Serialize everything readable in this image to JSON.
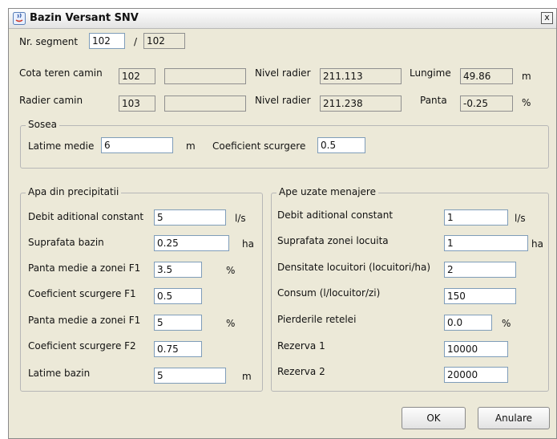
{
  "window": {
    "title": "Bazin Versant SNV",
    "close_glyph": "x"
  },
  "segment": {
    "label": "Nr. segment",
    "value": "102",
    "separator": "/",
    "total": "102"
  },
  "row_cota": {
    "label": "Cota teren camin",
    "value": "102",
    "value2": "",
    "nivel_label": "Nivel radier",
    "nivel_value": "211.113",
    "lungime_label": "Lungime",
    "lungime_value": "49.86",
    "unit": "m"
  },
  "row_radier": {
    "label": "Radier camin",
    "value": "103",
    "value2": "",
    "nivel_label": "Nivel radier",
    "nivel_value": "211.238",
    "panta_label": "Panta",
    "panta_value": "-0.25",
    "unit": "%"
  },
  "sosea": {
    "title": "Sosea",
    "latime_label": "Latime medie",
    "latime_value": "6",
    "latime_unit": "m",
    "coef_label": "Coeficient scurgere",
    "coef_value": "0.5"
  },
  "precipitatii": {
    "title": "Apa din precipitatii",
    "rows": [
      {
        "label": "Debit aditional constant",
        "value": "5",
        "unit": "l/s"
      },
      {
        "label": "Suprafata bazin",
        "value": "0.25",
        "unit": "ha"
      },
      {
        "label": "Panta medie a zonei F1",
        "value": "3.5",
        "unit": "%"
      },
      {
        "label": "Coeficient scurgere F1",
        "value": "0.5",
        "unit": ""
      },
      {
        "label": "Panta medie a zonei F1",
        "value": "5",
        "unit": "%"
      },
      {
        "label": "Coeficient scurgere F2",
        "value": "0.75",
        "unit": ""
      },
      {
        "label": "Latime bazin",
        "value": "5",
        "unit": "m"
      }
    ]
  },
  "menajere": {
    "title": "Ape uzate menajere",
    "rows": [
      {
        "label": "Debit aditional constant",
        "value": "1",
        "unit": "l/s"
      },
      {
        "label": "Suprafata zonei locuita",
        "value": "1",
        "unit": "ha"
      },
      {
        "label": "Densitate locuitori (locuitori/ha)",
        "value": "2",
        "unit": ""
      },
      {
        "label": "Consum (l/locuitor/zi)",
        "value": "150",
        "unit": ""
      },
      {
        "label": "Pierderile retelei",
        "value": "0.0",
        "unit": "%"
      },
      {
        "label": "Rezerva 1",
        "value": "10000",
        "unit": ""
      },
      {
        "label": "Rezerva 2",
        "value": "20000",
        "unit": ""
      }
    ]
  },
  "buttons": {
    "ok": "OK",
    "cancel": "Anulare"
  }
}
